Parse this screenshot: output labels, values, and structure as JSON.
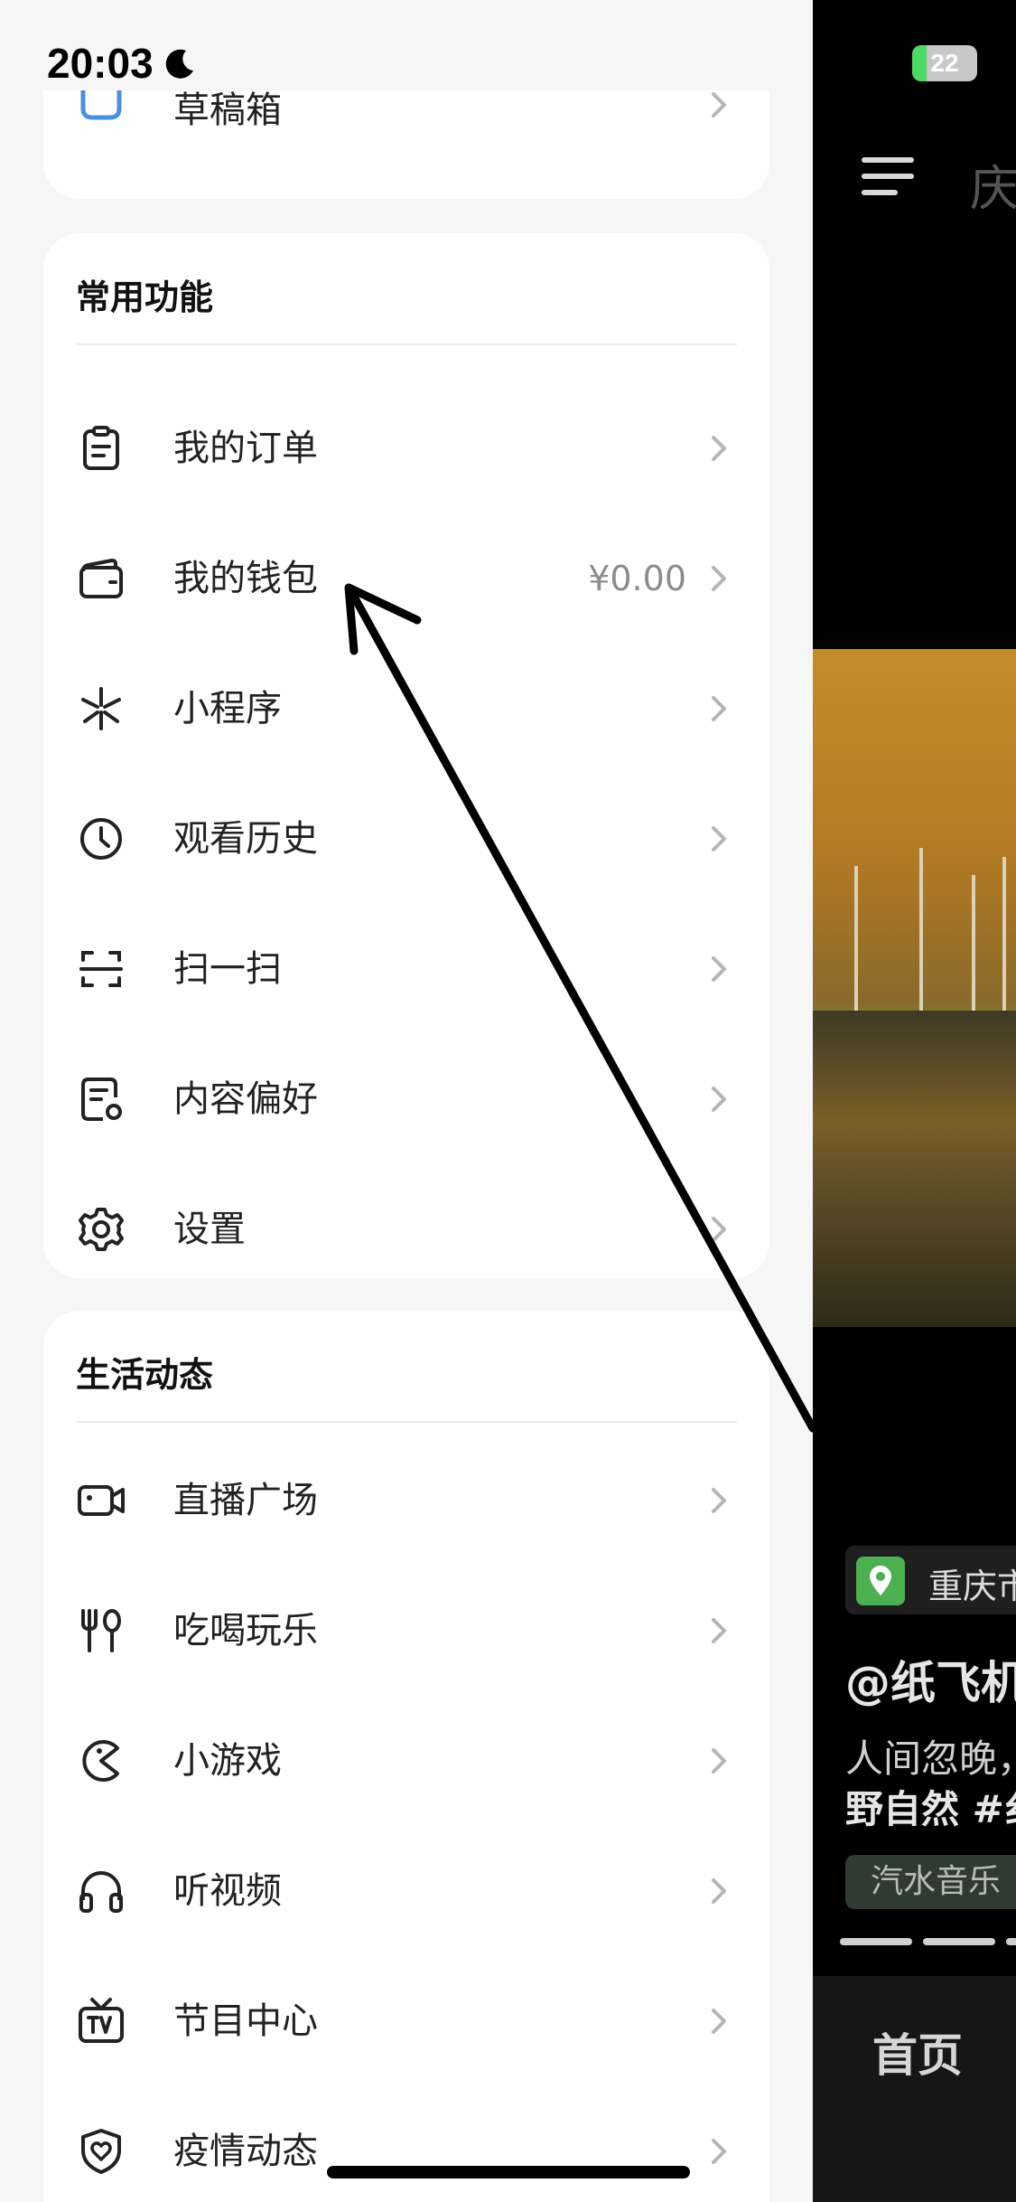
{
  "status_bar": {
    "time": "20:03",
    "battery_text": "22",
    "battery_level_percent": 22
  },
  "top_card": {
    "partial_item": {
      "label": "草稿箱",
      "icon": "drafts-box-icon"
    }
  },
  "common_functions": {
    "title": "常用功能",
    "items": [
      {
        "label": "我的订单",
        "icon": "order-clipboard-icon",
        "value": ""
      },
      {
        "label": "我的钱包",
        "icon": "wallet-icon",
        "value": "¥0.00"
      },
      {
        "label": "小程序",
        "icon": "mini-program-icon",
        "value": ""
      },
      {
        "label": "观看历史",
        "icon": "clock-icon",
        "value": ""
      },
      {
        "label": "扫一扫",
        "icon": "scan-icon",
        "value": ""
      },
      {
        "label": "内容偏好",
        "icon": "content-preference-icon",
        "value": ""
      },
      {
        "label": "设置",
        "icon": "gear-icon",
        "value": ""
      }
    ]
  },
  "life_updates": {
    "title": "生活动态",
    "items": [
      {
        "label": "直播广场",
        "icon": "live-camera-icon"
      },
      {
        "label": "吃喝玩乐",
        "icon": "fork-spoon-icon"
      },
      {
        "label": "小游戏",
        "icon": "pacman-game-icon"
      },
      {
        "label": "听视频",
        "icon": "headphones-icon"
      },
      {
        "label": "节目中心",
        "icon": "tv-icon"
      },
      {
        "label": "疫情动态",
        "icon": "shield-heart-icon"
      }
    ]
  },
  "video_panel": {
    "top_tab": "庆",
    "location": "重庆市",
    "author": "@纸飞机",
    "description_line1": "人间忽晚，",
    "description_line2": "野自然 #纟",
    "music": "汽水音乐",
    "nav_home": "首页"
  },
  "colors": {
    "accent_blue": "#4a90e2",
    "location_green": "#4caf50",
    "annotation_arrow": "#000000"
  }
}
